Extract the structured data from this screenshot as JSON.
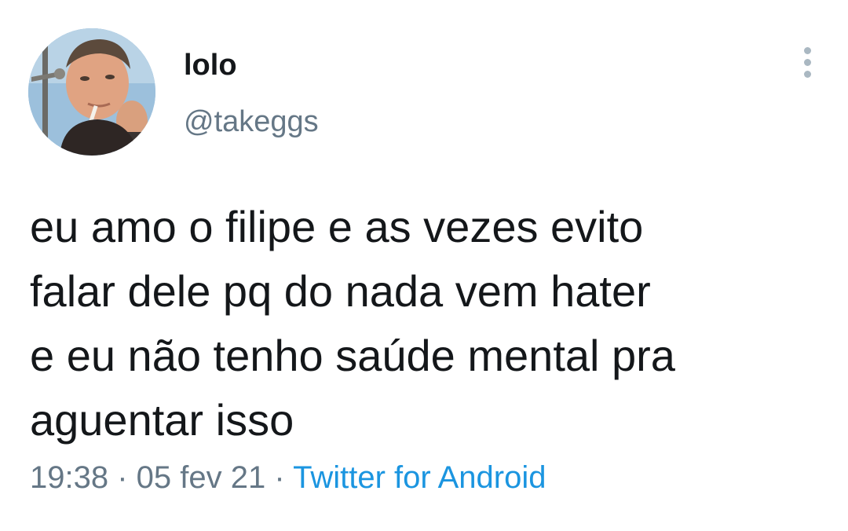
{
  "tweet": {
    "author": {
      "name": "lolo",
      "handle": "@takeggs"
    },
    "text_lines": [
      "eu amo o filipe e as vezes evito",
      "falar dele pq do nada vem hater",
      "e eu não tenho saúde mental pra",
      "aguentar isso"
    ],
    "time": "19:38",
    "date": "05 fev 21",
    "separator": "·",
    "source": "Twitter for Android"
  },
  "colors": {
    "text": "#14171a",
    "secondary": "#657786",
    "link": "#1b95e0",
    "more_icon": "#aab8c2"
  },
  "icons": {
    "more": "more-vertical-icon"
  }
}
